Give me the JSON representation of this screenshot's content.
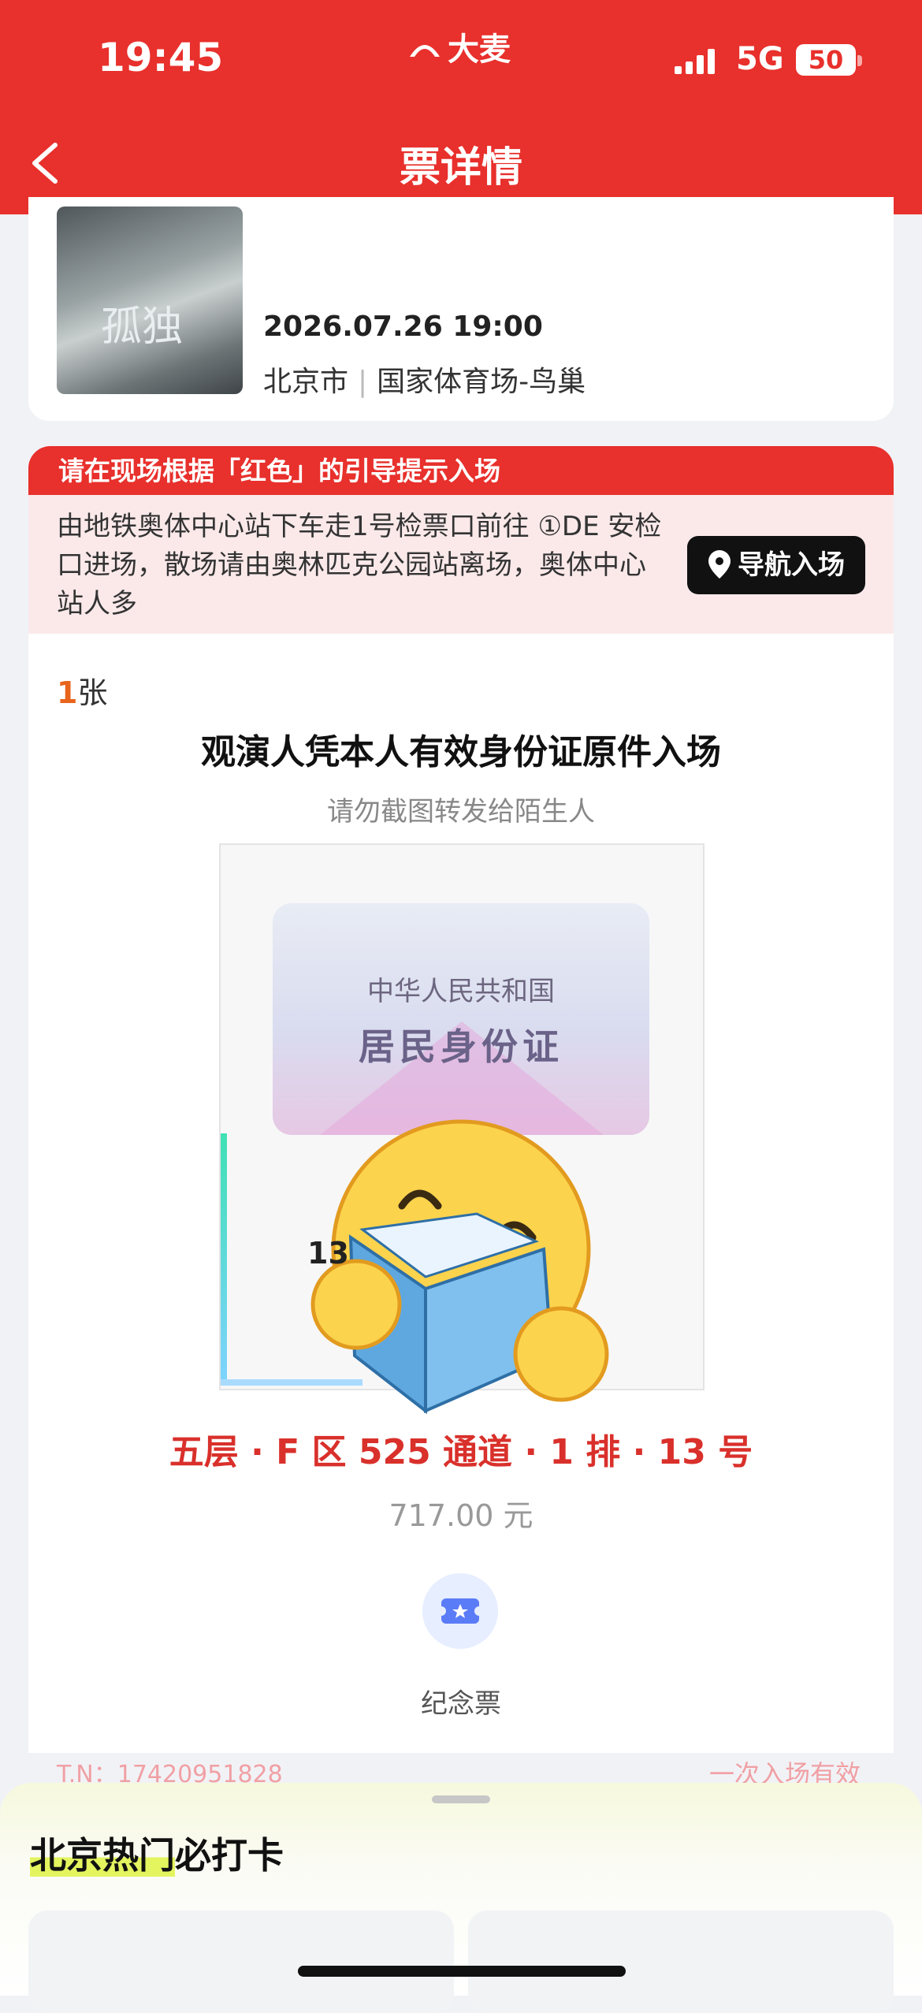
{
  "status_bar": {
    "time": "19:45",
    "brand": "大麦",
    "network": "5G",
    "battery": "50"
  },
  "nav": {
    "title": "票详情"
  },
  "event": {
    "poster_text": "孤独",
    "datetime": "2026.07.26 19:00",
    "city": "北京市",
    "venue": "国家体育场-鸟巢"
  },
  "entrance": {
    "header": "请在现场根据「红色」的引导提示入场",
    "guide": "由地铁奥体中心站下车走1号检票口前往 ①DE 安检口进场，散场请由奥林匹克公园站离场，奥体中心站人多",
    "nav_button": "导航入场"
  },
  "ticket": {
    "count": "1",
    "count_unit": "张",
    "rule": "观演人凭本人有效身份证原件入场",
    "warning": "请勿截图转发给陌生人",
    "id_line1": "中华人民共和国",
    "id_line2": "居民身份证",
    "seat_overlay": "13",
    "seat": "五层 · F 区 525 通道 · 1 排 · 13 号",
    "price": "717.00 元",
    "souvenir_label": "纪念票",
    "tn": "T.N：17420951828",
    "validity": "一次入场有效"
  },
  "bottom_sheet": {
    "title_highlight": "北京热门",
    "title_rest": "必打卡"
  },
  "colors": {
    "brand_red": "#e8302c",
    "seat_red": "#d9302b",
    "emoji_yellow": "#fcd34d",
    "book_blue": "#6fb7e8"
  }
}
